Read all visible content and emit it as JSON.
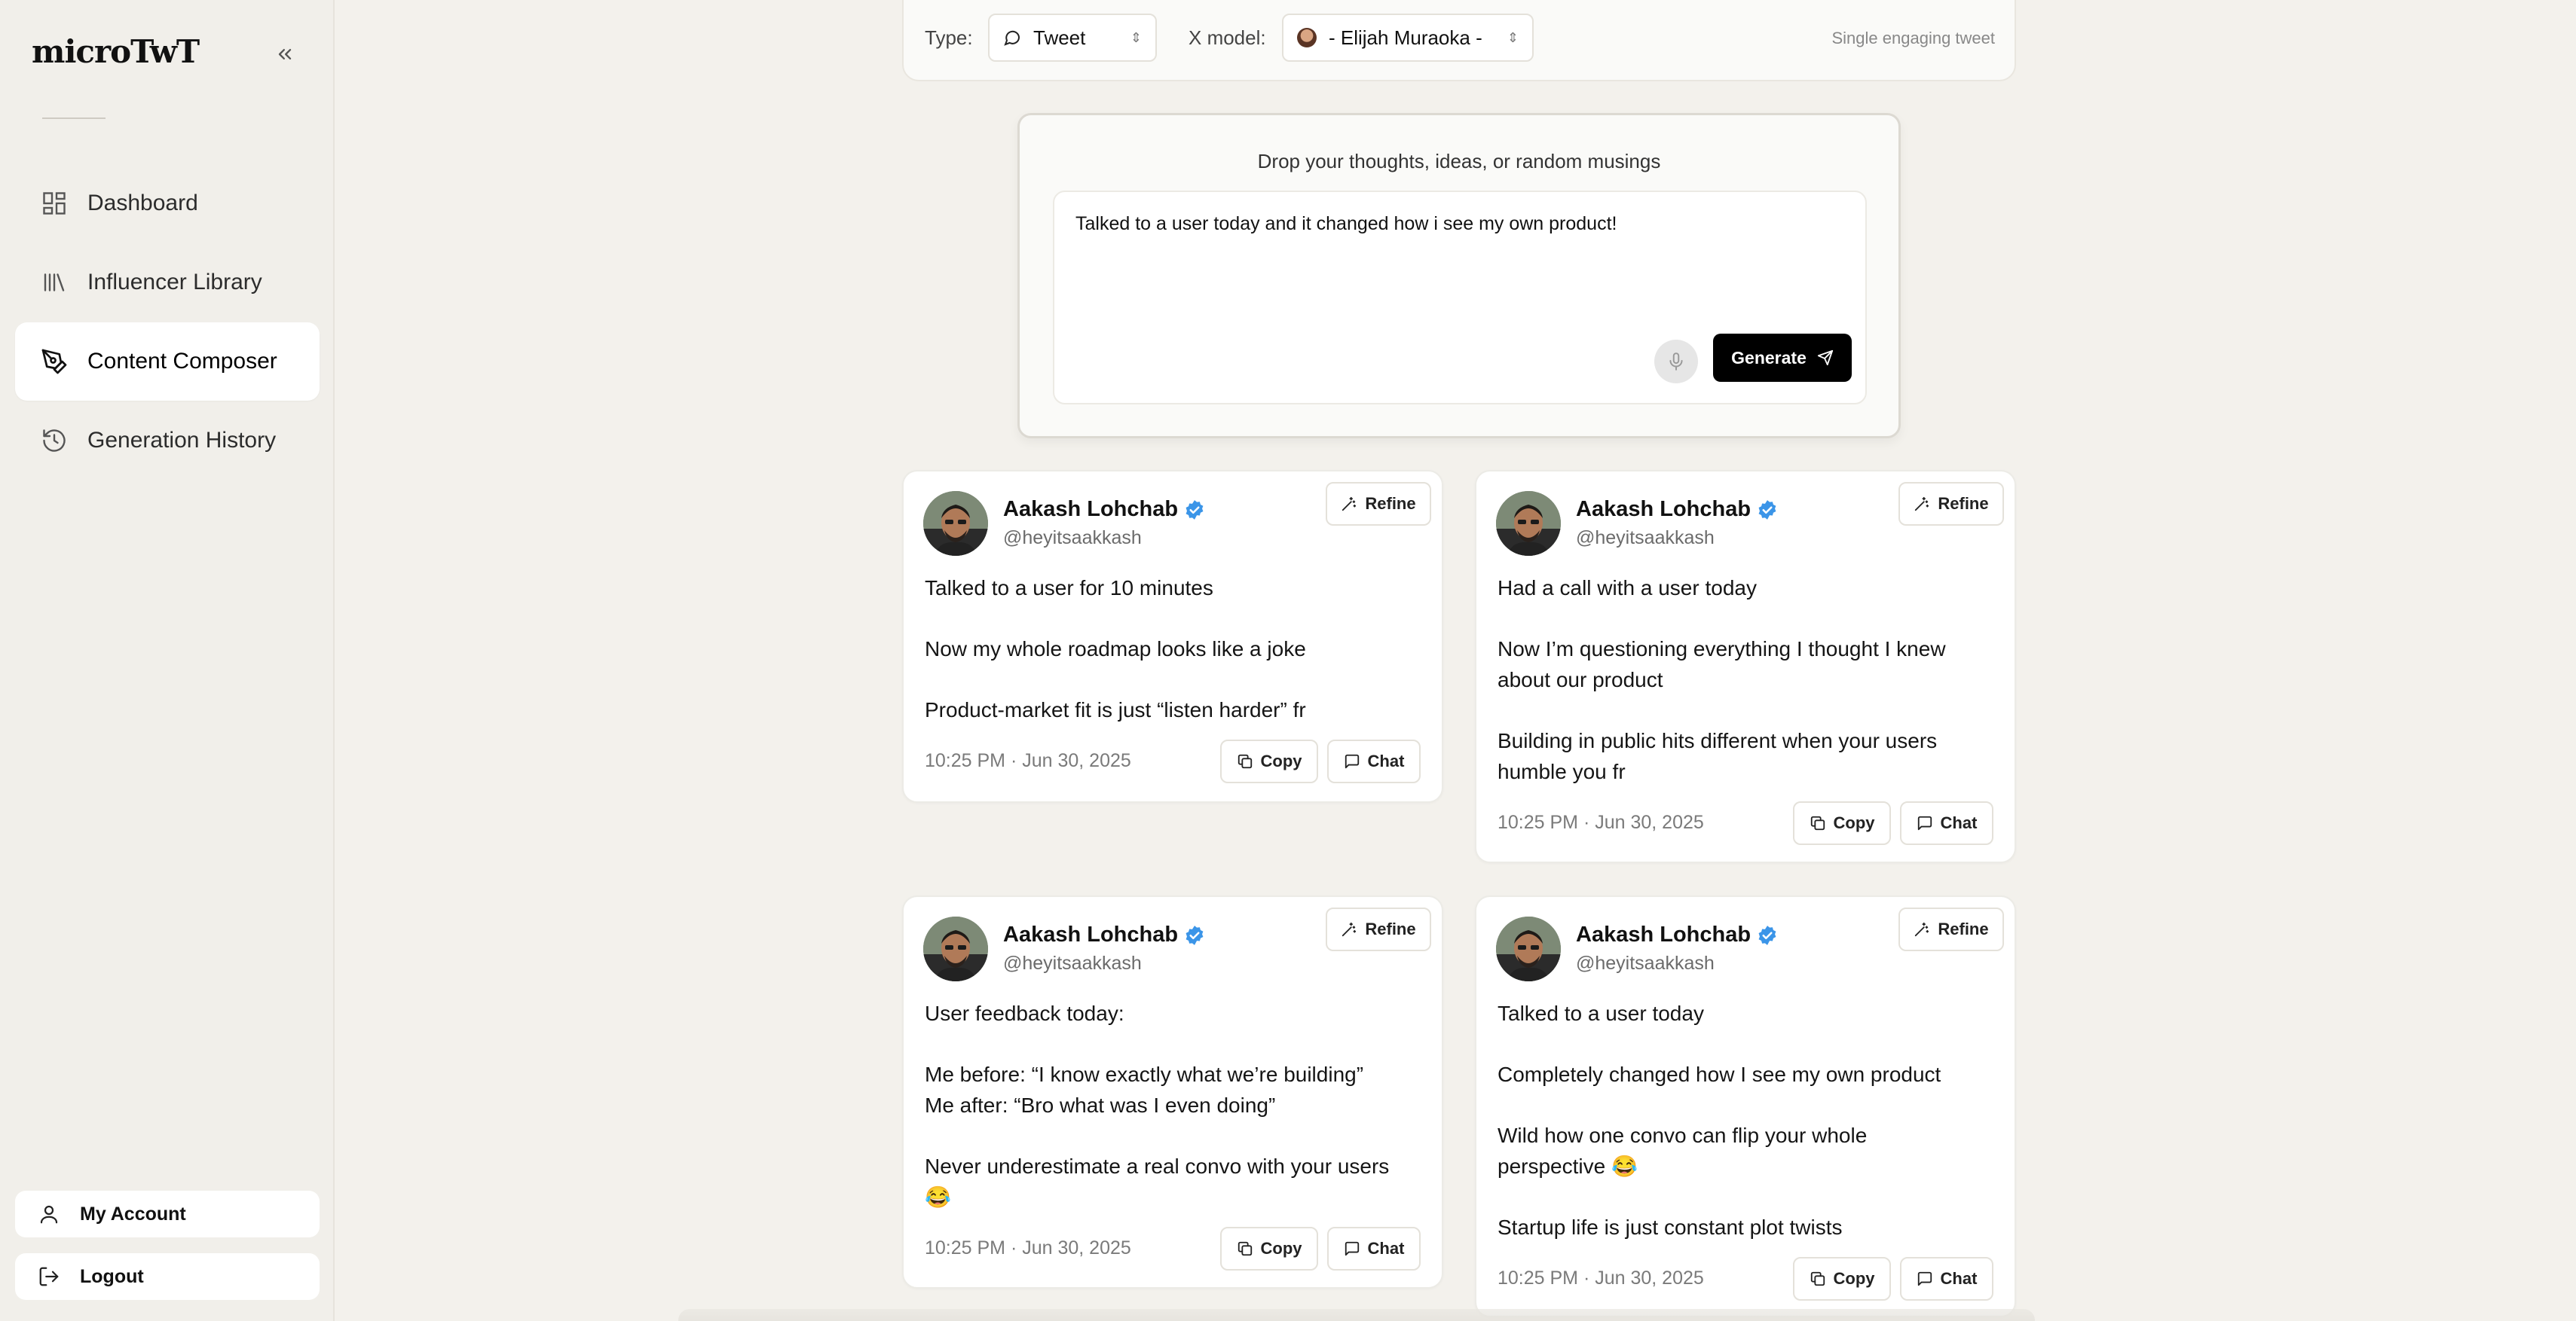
{
  "app": {
    "brand": "microTwT"
  },
  "sidebar": {
    "items": [
      {
        "label": "Dashboard",
        "icon": "dashboard-icon"
      },
      {
        "label": "Influencer Library",
        "icon": "library-icon"
      },
      {
        "label": "Content Composer",
        "icon": "pen-nib-icon",
        "active": true
      },
      {
        "label": "Generation History",
        "icon": "history-icon"
      }
    ],
    "account_label": "My Account",
    "logout_label": "Logout"
  },
  "topbar": {
    "type_label": "Type:",
    "type_value": "Tweet",
    "model_label": "X model:",
    "model_value": "- Elijah Muraoka -",
    "hint": "Single engaging tweet"
  },
  "composer": {
    "title": "Drop your thoughts, ideas, or random musings",
    "text": "Talked to a user today and it changed how i see my own product!",
    "generate_label": "Generate"
  },
  "tweets": [
    {
      "author": "Aakash Lohchab",
      "handle": "@heyitsaakkash",
      "lines": [
        "Talked to a user for 10 minutes",
        "",
        "Now my whole roadmap looks like a joke",
        "",
        "Product-market fit is just “listen harder” fr"
      ],
      "time": "10:25 PM · Jun 30, 2025",
      "refine_label": "Refine",
      "copy_label": "Copy",
      "chat_label": "Chat"
    },
    {
      "author": "Aakash Lohchab",
      "handle": "@heyitsaakkash",
      "lines": [
        "Had a call with a user today",
        "",
        "Now I’m questioning everything I thought I knew",
        "about our product",
        "",
        "Building in public hits different when your users",
        "humble you fr"
      ],
      "time": "10:25 PM · Jun 30, 2025",
      "refine_label": "Refine",
      "copy_label": "Copy",
      "chat_label": "Chat"
    },
    {
      "author": "Aakash Lohchab",
      "handle": "@heyitsaakkash",
      "lines": [
        "User feedback today:",
        "",
        "Me before: “I know exactly what we’re building”",
        "Me after: “Bro what was I even doing”",
        "",
        "Never underestimate a real convo with your users",
        "😂"
      ],
      "time": "10:25 PM · Jun 30, 2025",
      "refine_label": "Refine",
      "copy_label": "Copy",
      "chat_label": "Chat"
    },
    {
      "author": "Aakash Lohchab",
      "handle": "@heyitsaakkash",
      "lines": [
        "Talked to a user today",
        "",
        "Completely changed how I see my own product",
        "",
        "Wild how one convo can flip your whole",
        "perspective 😂",
        "",
        "Startup life is just constant plot twists"
      ],
      "time": "10:25 PM · Jun 30, 2025",
      "refine_label": "Refine",
      "copy_label": "Copy",
      "chat_label": "Chat"
    }
  ]
}
